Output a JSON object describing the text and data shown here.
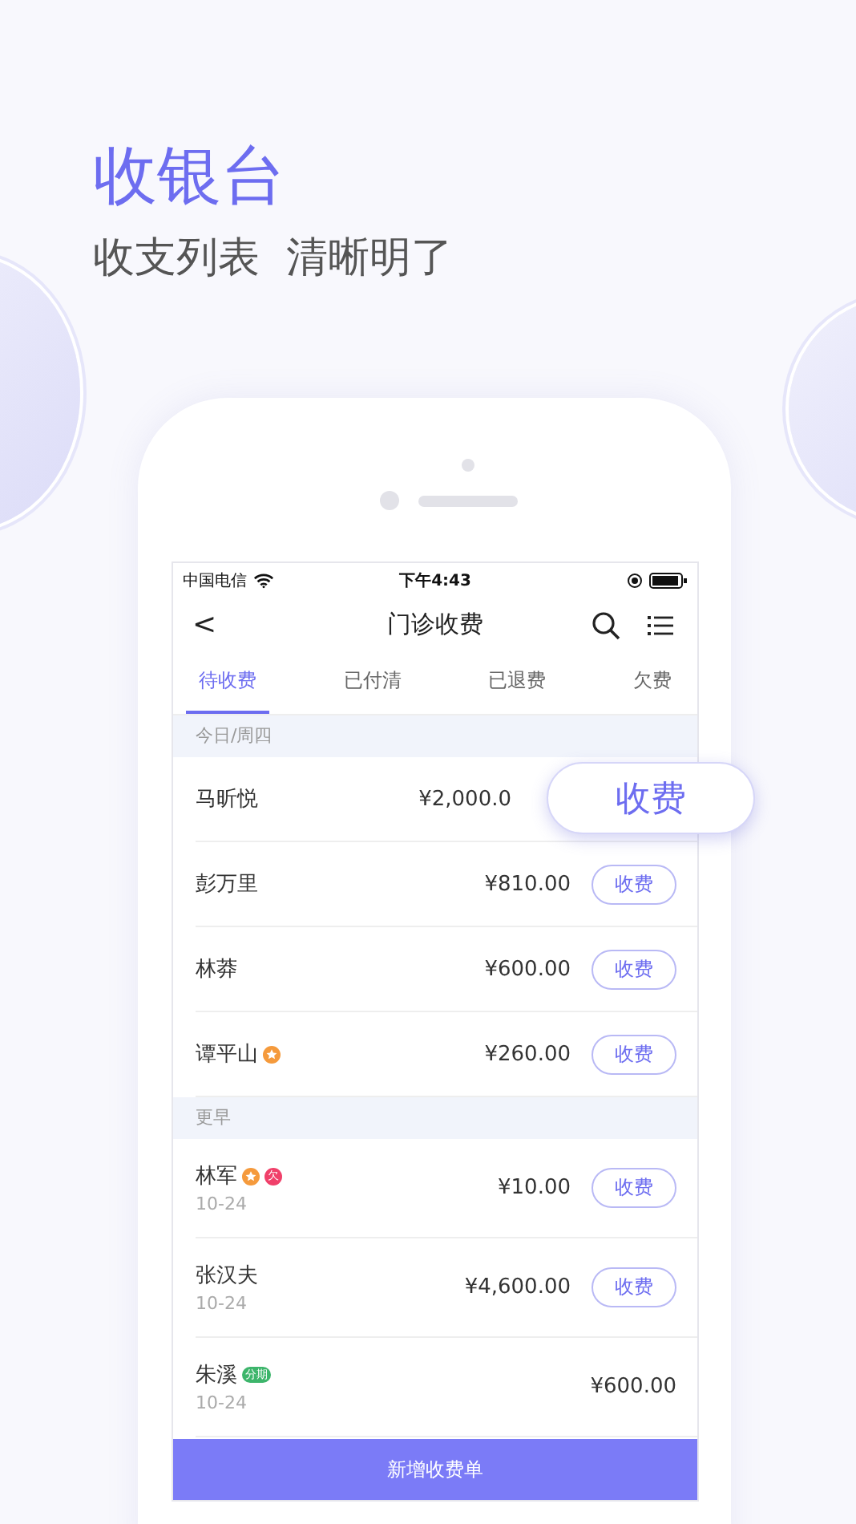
{
  "headline": "收银台",
  "subheadline": "收支列表  清晰明了",
  "status_bar": {
    "carrier": "中国电信",
    "time": "下午4:43"
  },
  "nav": {
    "back": "<",
    "title": "门诊收费"
  },
  "tabs": [
    {
      "label": "待收费",
      "selected": true
    },
    {
      "label": "已付清",
      "selected": false
    },
    {
      "label": "已退费",
      "selected": false
    },
    {
      "label": "欠费",
      "selected": false
    }
  ],
  "sections": [
    {
      "header": "今日/周四",
      "rows": [
        {
          "name": "马昕悦",
          "amount": "¥2,000.0",
          "action": {
            "kind": "callout",
            "label": "收费"
          }
        },
        {
          "name": "彭万里",
          "amount": "¥810.00",
          "action": {
            "kind": "button",
            "label": "收费"
          }
        },
        {
          "name": "林莽",
          "amount": "¥600.00",
          "action": {
            "kind": "button",
            "label": "收费"
          }
        },
        {
          "name": "谭平山",
          "amount": "¥260.00",
          "tags": [
            {
              "kind": "star"
            }
          ],
          "action": {
            "kind": "button",
            "label": "收费"
          }
        }
      ]
    },
    {
      "header": "更早",
      "rows": [
        {
          "name": "林军",
          "date": "10-24",
          "amount": "¥10.00",
          "tags": [
            {
              "kind": "star"
            },
            {
              "kind": "round",
              "text": "欠",
              "color": "#f0406a"
            }
          ],
          "action": {
            "kind": "button",
            "label": "收费"
          }
        },
        {
          "name": "张汉夫",
          "date": "10-24",
          "amount": "¥4,600.00",
          "action": {
            "kind": "button",
            "label": "收费"
          }
        },
        {
          "name": "朱溪",
          "date": "10-24",
          "amount": "¥600.00",
          "tags": [
            {
              "kind": "pill",
              "text": "分期",
              "color": "#3db56b"
            }
          ]
        }
      ]
    }
  ],
  "bottom_button": "新增收费单"
}
